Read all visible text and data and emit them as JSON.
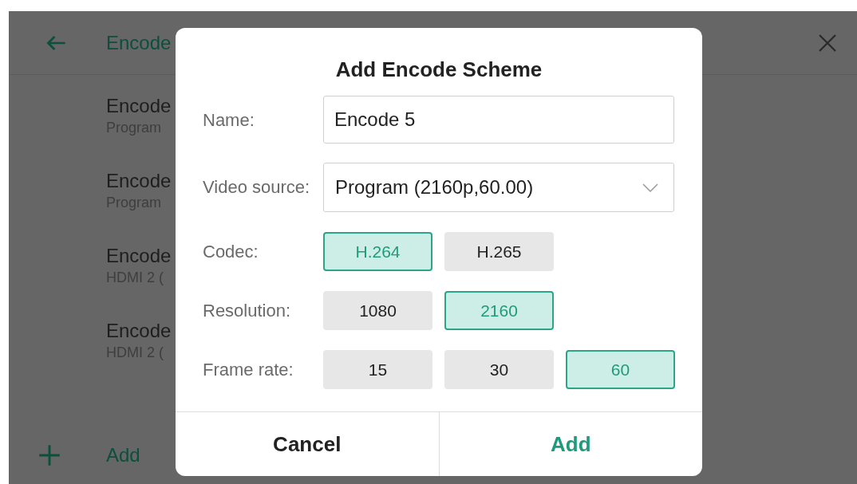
{
  "header": {
    "title": "Encode"
  },
  "list": [
    {
      "title": "Encode",
      "subtitle": "Program"
    },
    {
      "title": "Encode",
      "subtitle": "Program"
    },
    {
      "title": "Encode",
      "subtitle": "HDMI 2 ("
    },
    {
      "title": "Encode",
      "subtitle": "HDMI 2 ("
    }
  ],
  "add_label": "Add",
  "dialog": {
    "title": "Add Encode Scheme",
    "name": {
      "label": "Name:",
      "value": "Encode 5"
    },
    "video_source": {
      "label": "Video source:",
      "value": "Program (2160p,60.00)"
    },
    "option_groups": [
      {
        "label": "Codec:",
        "options": [
          {
            "label": "H.264",
            "selected": true
          },
          {
            "label": "H.265",
            "selected": false
          }
        ]
      },
      {
        "label": "Resolution:",
        "options": [
          {
            "label": "1080",
            "selected": false
          },
          {
            "label": "2160",
            "selected": true
          }
        ]
      },
      {
        "label": "Frame rate:",
        "options": [
          {
            "label": "15",
            "selected": false
          },
          {
            "label": "30",
            "selected": false
          },
          {
            "label": "60",
            "selected": true
          }
        ]
      }
    ],
    "cancel": "Cancel",
    "confirm": "Add"
  }
}
